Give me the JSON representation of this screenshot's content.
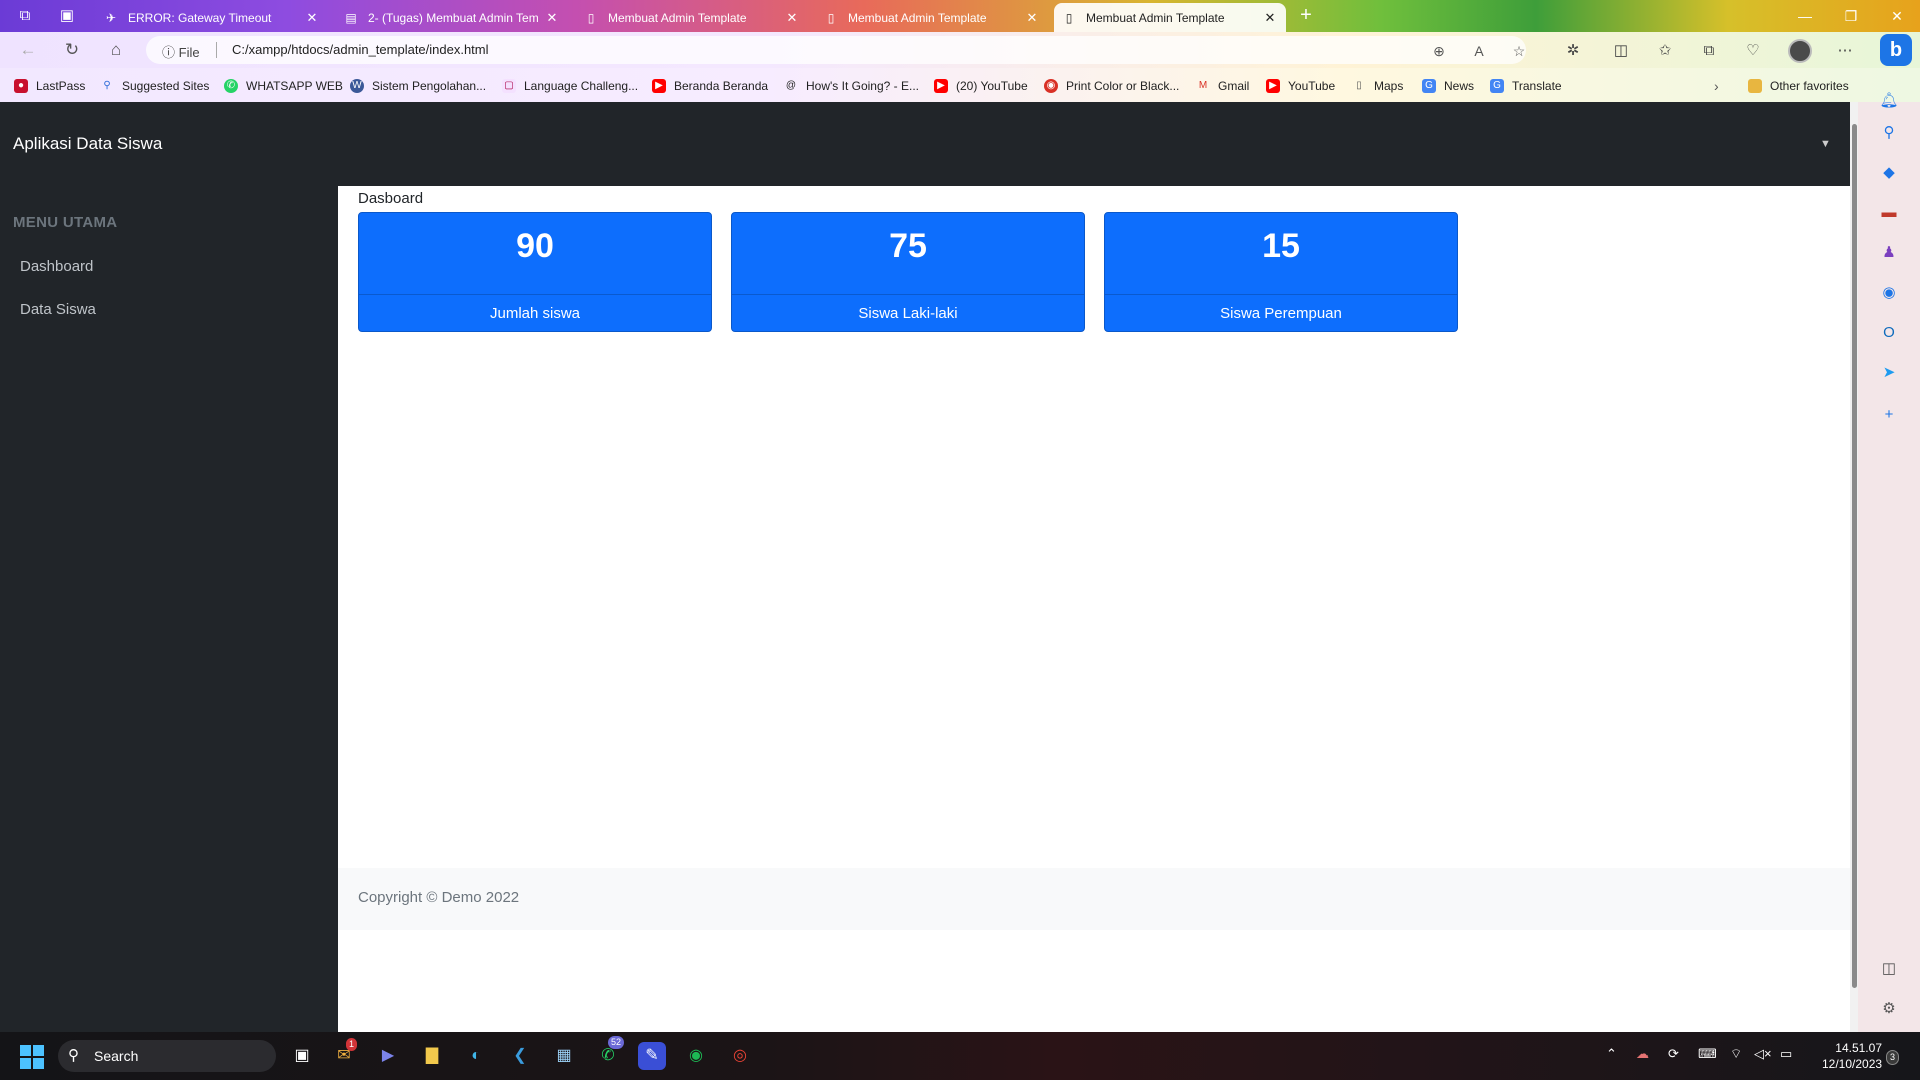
{
  "browser": {
    "tabs": [
      {
        "title": "ERROR: Gateway Timeout",
        "active": false
      },
      {
        "title": "2- (Tugas) Membuat Admin Tem",
        "active": false
      },
      {
        "title": "Membuat Admin Template",
        "active": false
      },
      {
        "title": "Membuat Admin Template",
        "active": false
      },
      {
        "title": "Membuat Admin Template",
        "active": true
      }
    ],
    "address": {
      "scheme_label": "File",
      "url": "C:/xampp/htdocs/admin_template/index.html"
    },
    "bookmarks": [
      "LastPass",
      "Suggested Sites",
      "WHATSAPP WEB",
      "Sistem Pengolahan...",
      "Language Challeng...",
      "Beranda Beranda",
      "How's It Going? - E...",
      "(20) YouTube",
      "Print Color or Black...",
      "Gmail",
      "YouTube",
      "Maps",
      "News",
      "Translate"
    ],
    "other_favorites": "Other favorites"
  },
  "app": {
    "brand": "Aplikasi Data Siswa",
    "menu_heading": "MENU UTAMA",
    "menu": [
      "Dashboard",
      "Data Siswa"
    ],
    "breadcrumb": "Dasboard",
    "cards": [
      {
        "value": "90",
        "label": "Jumlah siswa"
      },
      {
        "value": "75",
        "label": "Siswa Laki-laki"
      },
      {
        "value": "15",
        "label": "Siswa Perempuan"
      }
    ],
    "footer": "Copyright © Demo 2022",
    "accent_color": "#0d6efd",
    "dark_color": "#212529"
  },
  "taskbar": {
    "search_label": "Search",
    "badges": {
      "mail": "1",
      "whatsapp": "52"
    },
    "time": "14.51.07",
    "date": "12/10/2023",
    "notification_count": "3"
  }
}
